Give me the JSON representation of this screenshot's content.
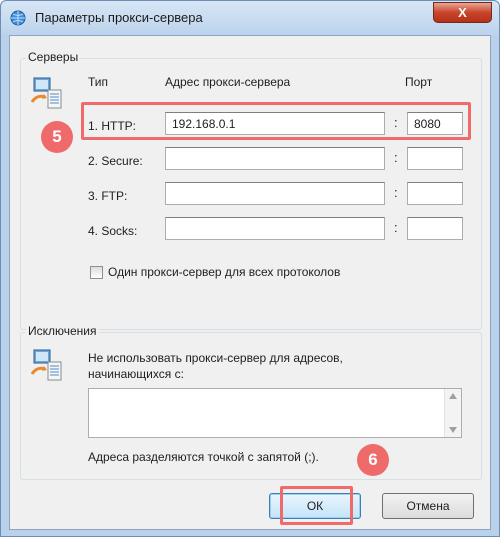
{
  "window": {
    "title": "Параметры прокси-сервера",
    "close_glyph": "X",
    "icon": "globe-settings-icon"
  },
  "servers": {
    "group_title": "Серверы",
    "col_type": "Тип",
    "col_address": "Адрес прокси-сервера",
    "col_port": "Порт",
    "rows": [
      {
        "type": "1. HTTP:",
        "address": "192.168.0.1",
        "port": "8080"
      },
      {
        "type": "2. Secure:",
        "address": "",
        "port": ""
      },
      {
        "type": "3. FTP:",
        "address": "",
        "port": ""
      },
      {
        "type": "4. Socks:",
        "address": "",
        "port": ""
      }
    ],
    "colon": ":",
    "same_proxy_label": "Один прокси-сервер для всех протоколов",
    "same_proxy_checked": false
  },
  "exceptions": {
    "group_title": "Исключения",
    "description": "Не использовать прокси-сервер для адресов, начинающихся с:",
    "value": "",
    "hint": "Адреса разделяются точкой с запятой (;)."
  },
  "buttons": {
    "ok": "ОК",
    "cancel": "Отмена"
  },
  "annotations": {
    "step5": "5",
    "step6": "6",
    "highlight_color": "#ef6b6b"
  }
}
